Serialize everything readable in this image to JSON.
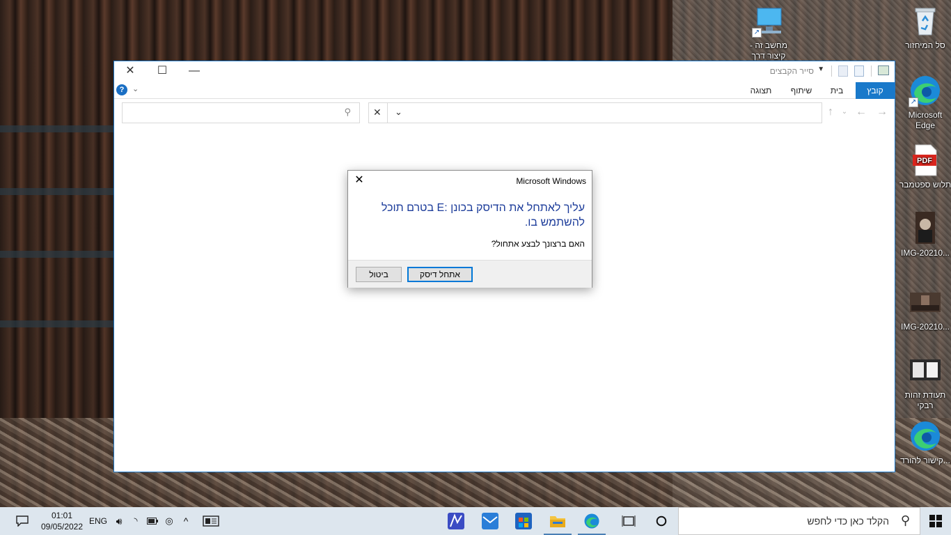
{
  "desktop": {
    "icons": [
      {
        "label": "סל המיחזור"
      },
      {
        "label": "Microsoft Edge"
      },
      {
        "label": "תלוש ספטמבר"
      },
      {
        "label": "IMG-20210..."
      },
      {
        "label": "IMG-20210..."
      },
      {
        "label": "תעודת זהות רבקי"
      },
      {
        "label": "קישור להורד..."
      },
      {
        "label": "מחשב זה - קיצור דרך"
      }
    ]
  },
  "explorer": {
    "title": "סייר הקבצים",
    "tabs": {
      "file": "קובץ",
      "home": "בית",
      "share": "שיתוף",
      "view": "תצוגה"
    }
  },
  "dialog": {
    "title": "Microsoft Windows",
    "message": "עליך לאתחל את הדיסק בכונן :E בטרם תוכל להשתמש בו.",
    "question": "האם ברצונך לבצע אתחול?",
    "format_button": "אתחל דיסק",
    "cancel_button": "ביטול"
  },
  "taskbar": {
    "search_placeholder": "הקלד כאן כדי לחפש",
    "time": "01:01",
    "date": "09/05/2022",
    "language": "ENG"
  },
  "colors": {
    "accent": "#1979ca",
    "dialog_text": "#1c3c9a",
    "taskbar": "#dde6ee"
  }
}
